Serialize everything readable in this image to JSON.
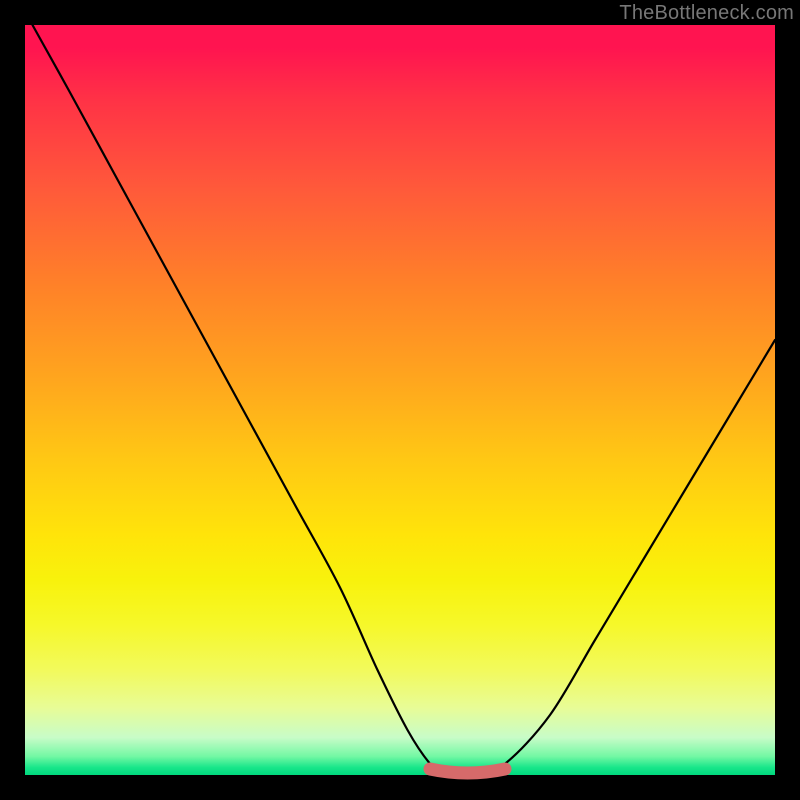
{
  "watermark": "TheBottleneck.com",
  "colors": {
    "frame_bg": "#000000",
    "curve_stroke": "#000000",
    "flat_segment_stroke": "#d66a6a"
  },
  "chart_data": {
    "type": "line",
    "title": "",
    "xlabel": "",
    "ylabel": "",
    "xlim": [
      0,
      100
    ],
    "ylim": [
      0,
      100
    ],
    "series": [
      {
        "name": "bottleneck-curve",
        "x": [
          1,
          6,
          12,
          18,
          24,
          30,
          36,
          42,
          47,
          51,
          54,
          56,
          60,
          64,
          70,
          76,
          82,
          88,
          94,
          100
        ],
        "y": [
          100,
          91,
          80,
          69,
          58,
          47,
          36,
          25,
          14,
          6,
          1.5,
          0,
          0,
          1.5,
          8,
          18,
          28,
          38,
          48,
          58
        ]
      }
    ],
    "annotations": [
      {
        "name": "flat-bottom-segment",
        "x_range": [
          54,
          64
        ],
        "y": 0
      }
    ]
  }
}
